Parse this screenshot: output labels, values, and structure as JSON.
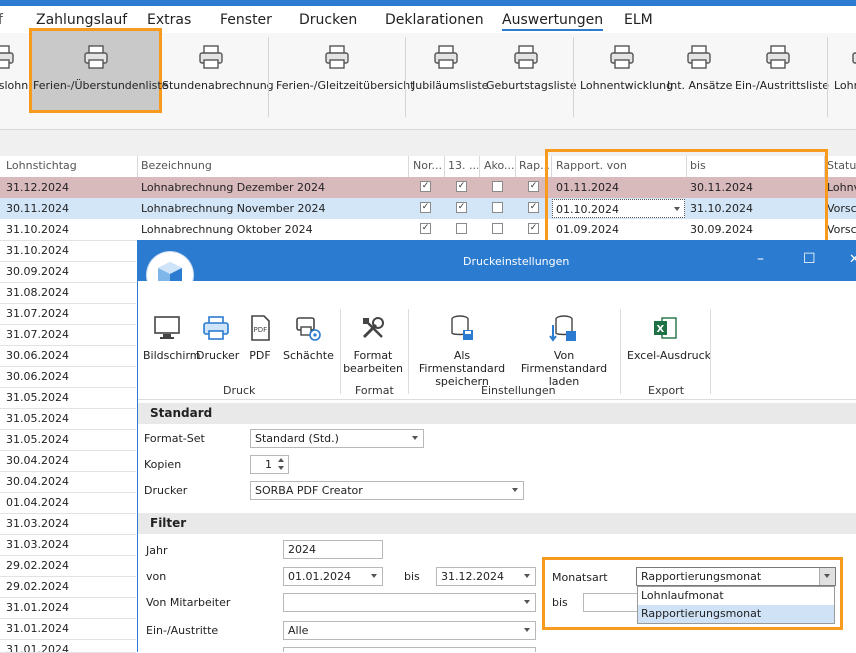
{
  "menu": {
    "items": [
      "Zahlungslauf",
      "Extras",
      "Fenster",
      "Drucken",
      "Deklarationen",
      "Auswertungen",
      "ELM"
    ],
    "leading_fragment": "f",
    "active": "Auswertungen"
  },
  "ribbon": {
    "buttons": [
      "eslohn",
      "Ferien-/Überstundenliste",
      "Stundenabrechnung",
      "Ferien-/Gleitzeitübersicht",
      "Jubiläumsliste",
      "Geburtstagsliste",
      "Lohnentwicklung",
      "Int. Ansätze",
      "Ein-/Austrittsliste",
      "Lohn"
    ],
    "selected": "Ferien-/Überstundenliste"
  },
  "grid": {
    "headers": [
      "Lohnstichtag",
      "Bezeichnung",
      "Nor...",
      "13. ...",
      "Ako...",
      "Rap...",
      "Rapport. von",
      "bis",
      "Status"
    ],
    "rows": [
      {
        "date": "31.12.2024",
        "bez": "Lohnabrechnung Dezember 2024",
        "c1": true,
        "c2": true,
        "c3": false,
        "c4": true,
        "von": "01.11.2024",
        "bis": "30.11.2024",
        "status": "Lohnve"
      },
      {
        "date": "30.11.2024",
        "bez": "Lohnabrechnung November 2024",
        "c1": true,
        "c2": true,
        "c3": false,
        "c4": true,
        "von": "01.10.2024",
        "bis": "31.10.2024",
        "status": "Vorsch"
      },
      {
        "date": "31.10.2024",
        "bez": "Lohnabrechnung Oktober 2024",
        "c1": true,
        "c2": false,
        "c3": false,
        "c4": true,
        "von": "01.09.2024",
        "bis": "30.09.2024",
        "status": "Vorsch"
      }
    ],
    "more_dates": [
      "31.10.2024",
      "30.09.2024",
      "31.08.2024",
      "31.07.2024",
      "31.07.2024",
      "30.06.2024",
      "30.06.2024",
      "31.05.2024",
      "31.05.2024",
      "31.05.2024",
      "30.04.2024",
      "30.04.2024",
      "01.04.2024",
      "31.03.2024",
      "31.03.2024",
      "29.02.2024",
      "29.02.2024",
      "31.01.2024",
      "31.01.2024",
      "31.01.2024"
    ],
    "colors": {
      "row_selected": "#d8b9bc",
      "row_focus": "#d3e6f8",
      "highlight": "#f79a1d"
    }
  },
  "dialog": {
    "title": "Druckeinstellungen",
    "controls": {
      "minimize": "–",
      "maximize": "☐",
      "close": "✕"
    },
    "ribbon": {
      "buttons": [
        {
          "label": "Bildschirm",
          "icon": "monitor-icon"
        },
        {
          "label": "Drucker",
          "icon": "printer-icon"
        },
        {
          "label": "PDF",
          "icon": "pdf-icon"
        },
        {
          "label": "Schächte",
          "icon": "tray-icon"
        },
        {
          "label": "Format bearbeiten",
          "icon": "tools-icon"
        },
        {
          "label": "Als Firmenstandard speichern",
          "icon": "db-save-icon"
        },
        {
          "label": "Von Firmenstandard laden",
          "icon": "db-load-icon"
        },
        {
          "label": "Excel-Ausdruck",
          "icon": "excel-icon"
        }
      ],
      "groups": [
        "Druck",
        "Format",
        "Einstellungen",
        "Export"
      ]
    },
    "standard": {
      "header": "Standard",
      "format_set_label": "Format-Set",
      "format_set_value": "Standard (Std.)",
      "kopien_label": "Kopien",
      "kopien_value": "1",
      "drucker_label": "Drucker",
      "drucker_value": "SORBA PDF Creator"
    },
    "filter": {
      "header": "Filter",
      "jahr_label": "Jahr",
      "jahr_value": "2024",
      "von_label": "von",
      "von_value": "01.01.2024",
      "bis_label": "bis",
      "bis_value": "31.12.2024",
      "von_mitarbeiter_label": "Von Mitarbeiter",
      "von_mitarbeiter_value": "",
      "ein_austritte_label": "Ein-/Austritte",
      "ein_austritte_value": "Alle",
      "monatsart_label": "Monatsart",
      "monatsart_value": "Rapportierungsmonat",
      "monatsart_bis_label": "bis",
      "monatsart_options": [
        "Lohnlaufmonat",
        "Rapportierungsmonat"
      ]
    }
  }
}
